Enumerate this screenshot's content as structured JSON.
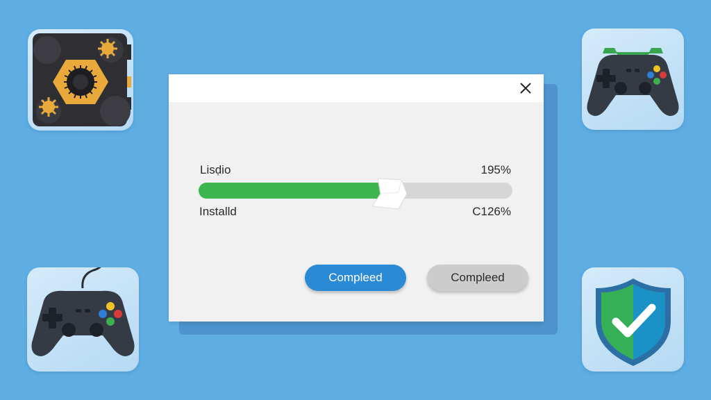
{
  "desktop": {
    "background": "#5faee3",
    "icons": [
      {
        "name": "gear-chip-icon"
      },
      {
        "name": "gamepad-icon"
      },
      {
        "name": "gamepad-icon"
      },
      {
        "name": "shield-check-icon"
      }
    ]
  },
  "dialog": {
    "close_icon": "close-icon",
    "labels": {
      "top_left": "Lisḍio",
      "top_right": "195%",
      "bottom_left": "Installd",
      "bottom_right": "C126%"
    },
    "progress": {
      "fraction": 0.62,
      "fill_color": "#3db64f",
      "track_color": "#d6d6d6"
    },
    "buttons": {
      "primary_label": "Compleed",
      "secondary_label": "Compleed"
    },
    "colors": {
      "primary_button": "#2a8ad6",
      "secondary_button": "#cccccc"
    }
  }
}
